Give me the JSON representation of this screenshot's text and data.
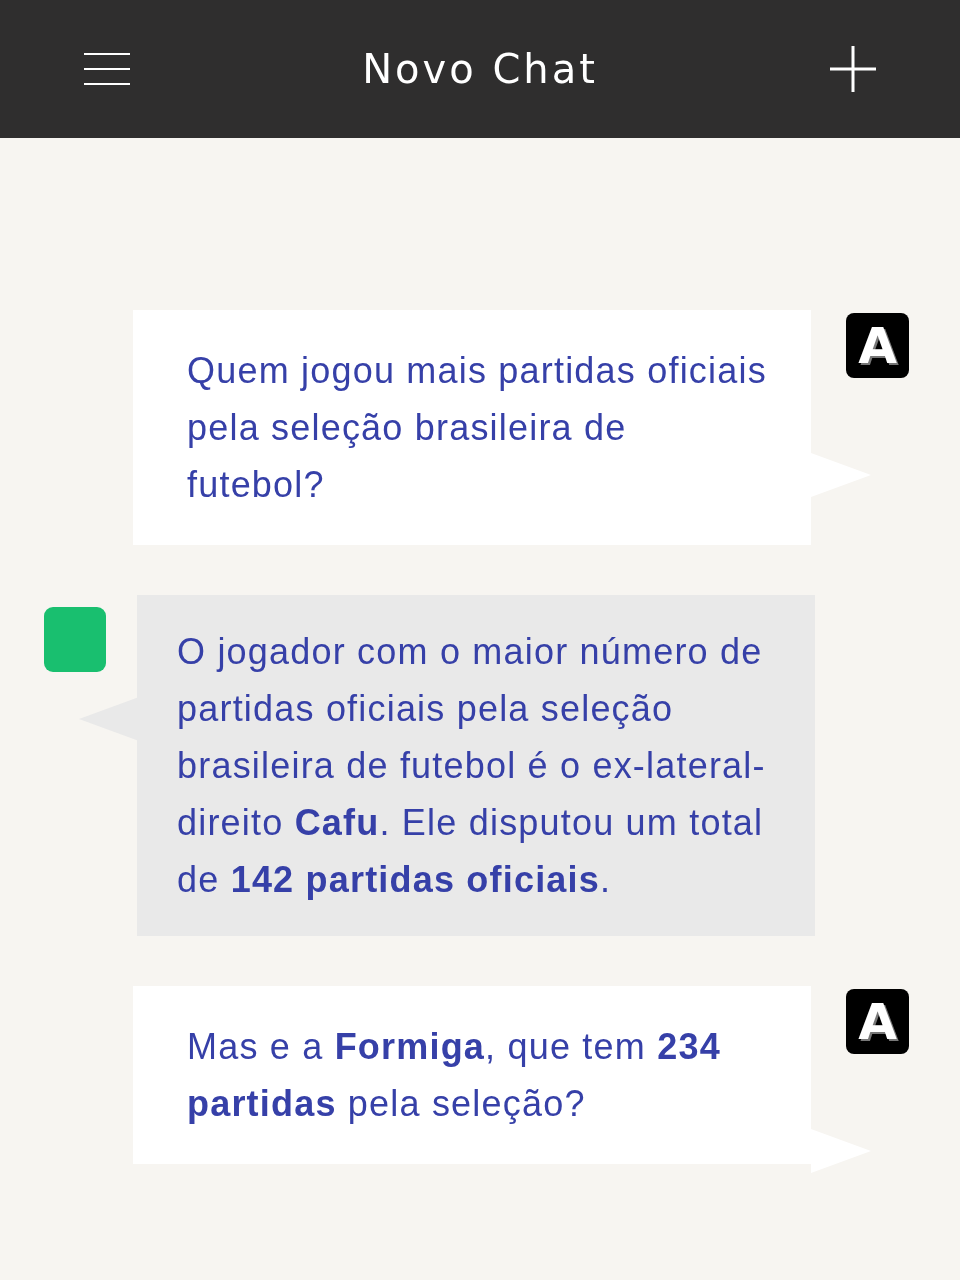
{
  "header": {
    "title": "Novo Chat"
  },
  "messages": [
    {
      "kind": "user",
      "avatar": "A",
      "text": "Quem jogou mais partidas oficiais pela seleção brasileira de futebol?"
    },
    {
      "kind": "bot",
      "text": "O jogador com o maior número de partidas oficiais pela seleção brasileira de futebol é o ex-lateral-direito **Cafu**. Ele disputou um total de **142 partidas oficiais**."
    },
    {
      "kind": "user",
      "avatar": "A",
      "text": "Mas e a **Formiga**, que tem **234 partidas** pela seleção?"
    }
  ]
}
